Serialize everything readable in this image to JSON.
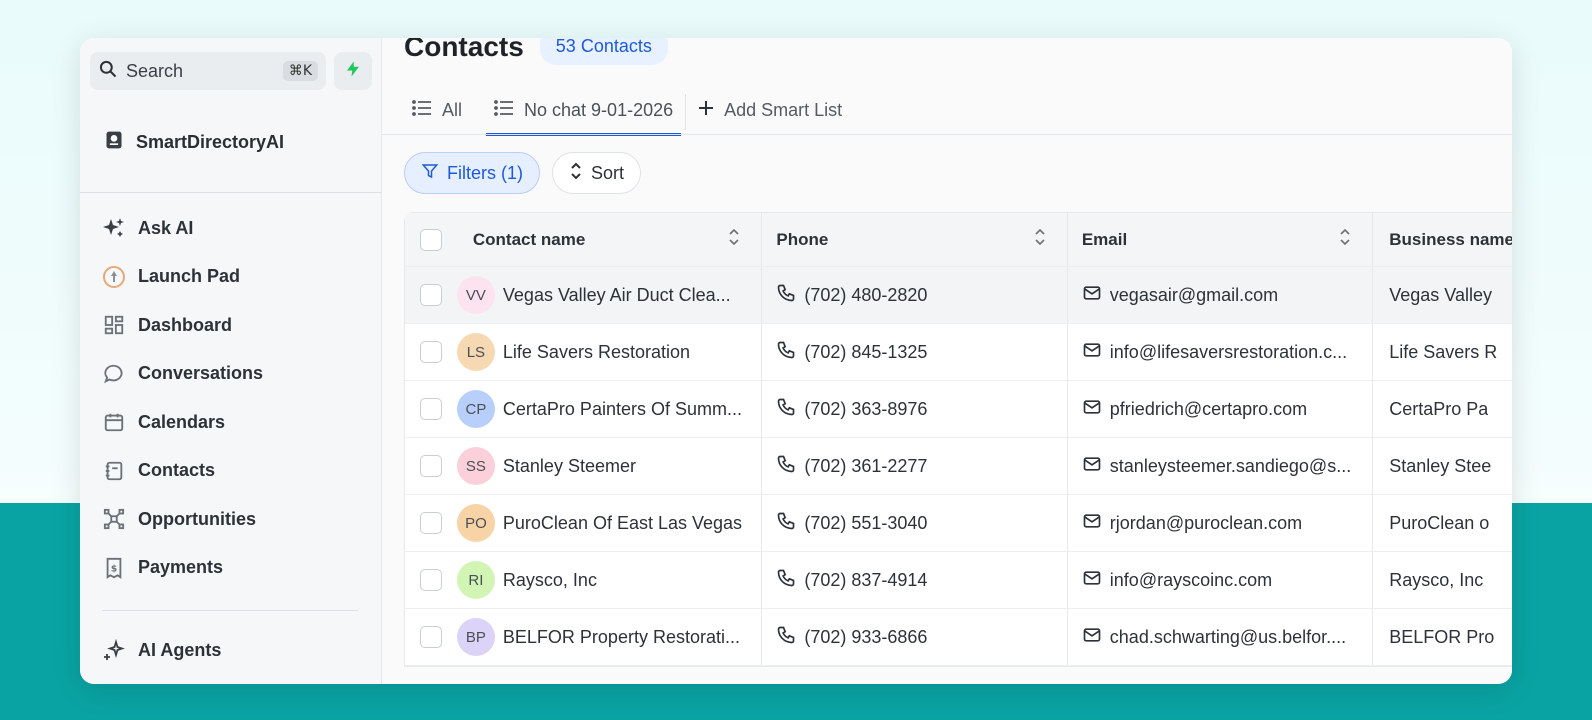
{
  "sidebar": {
    "search_label": "Search",
    "search_shortcut": "⌘K",
    "brand": "SmartDirectoryAI",
    "items": [
      {
        "label": "Ask AI",
        "icon": "sparkles-icon"
      },
      {
        "label": "Launch Pad",
        "icon": "rocket-icon"
      },
      {
        "label": "Dashboard",
        "icon": "dashboard-icon"
      },
      {
        "label": "Conversations",
        "icon": "chat-bubble-icon"
      },
      {
        "label": "Calendars",
        "icon": "calendar-icon"
      },
      {
        "label": "Contacts",
        "icon": "contacts-book-icon"
      },
      {
        "label": "Opportunities",
        "icon": "opportunities-icon"
      },
      {
        "label": "Payments",
        "icon": "receipt-dollar-icon"
      }
    ],
    "items2": [
      {
        "label": "AI Agents",
        "icon": "sparkles-icon"
      }
    ]
  },
  "main": {
    "title": "Contacts",
    "count_badge": "53 Contacts",
    "tabs": [
      {
        "label": "All",
        "active": false
      },
      {
        "label": "No chat 9-01-2026",
        "active": true
      }
    ],
    "add_smart_list": "Add Smart List",
    "filters_label": "Filters (1)",
    "sort_label": "Sort",
    "columns": [
      "Contact name",
      "Phone",
      "Email",
      "Business name"
    ],
    "rows": [
      {
        "initials": "VV",
        "avatar_color": "#fde3ef",
        "name": "Vegas Valley Air Duct Clea...",
        "phone": "(702) 480-2820",
        "email": "vegasair@gmail.com",
        "business": "Vegas Valley"
      },
      {
        "initials": "LS",
        "avatar_color": "#f6d9b3",
        "name": "Life Savers Restoration",
        "phone": "(702) 845-1325",
        "email": "info@lifesaversrestoration.c...",
        "business": "Life Savers R"
      },
      {
        "initials": "CP",
        "avatar_color": "#b8cffb",
        "name": "CertaPro Painters Of Summ...",
        "phone": "(702) 363-8976",
        "email": "pfriedrich@certapro.com",
        "business": "CertaPro Pa"
      },
      {
        "initials": "SS",
        "avatar_color": "#fbd0da",
        "name": "Stanley Steemer",
        "phone": "(702) 361-2277",
        "email": "stanleysteemer.sandiego@s...",
        "business": "Stanley Stee"
      },
      {
        "initials": "PO",
        "avatar_color": "#f7d3a6",
        "name": "PuroClean Of East Las Vegas",
        "phone": "(702) 551-3040",
        "email": "rjordan@puroclean.com",
        "business": "PuroClean o"
      },
      {
        "initials": "RI",
        "avatar_color": "#d2f5b6",
        "name": "Raysco, Inc",
        "phone": "(702) 837-4914",
        "email": "info@rayscoinc.com",
        "business": "Raysco, Inc"
      },
      {
        "initials": "BP",
        "avatar_color": "#dcd3f8",
        "name": "BELFOR Property Restorati...",
        "phone": "(702) 933-6866",
        "email": "chad.schwarting@us.belfor....",
        "business": "BELFOR Pro"
      }
    ]
  },
  "colors": {
    "accent": "#1d5bd6",
    "bolt": "#22c55e",
    "teal_band": "#0aa3a3"
  }
}
